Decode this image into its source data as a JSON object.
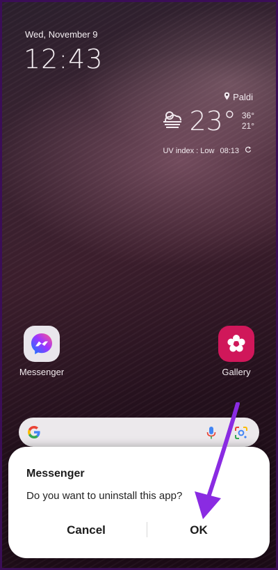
{
  "lockscreen": {
    "date": "Wed, November 9",
    "time": "12:43"
  },
  "weather": {
    "location": "Paldi",
    "temperature": "23°",
    "high": "36°",
    "low": "21°",
    "uv": "UV index : Low",
    "updated": "08:13",
    "icons": [
      "location-pin-icon",
      "cloudy-fog-icon",
      "refresh-icon"
    ]
  },
  "apps": [
    {
      "label": "Messenger",
      "icon": "messenger-icon"
    },
    {
      "label": "Gallery",
      "icon": "gallery-flower-icon"
    }
  ],
  "search": {
    "icons": [
      "google-g-icon",
      "microphone-icon",
      "google-lens-icon"
    ]
  },
  "dialog": {
    "title": "Messenger",
    "message": "Do you want to uninstall this app?",
    "cancel_label": "Cancel",
    "ok_label": "OK"
  },
  "colors": {
    "accent_arrow": "#8a2be2",
    "gallery": "#d0175a",
    "dialog_bg": "#ffffff"
  }
}
